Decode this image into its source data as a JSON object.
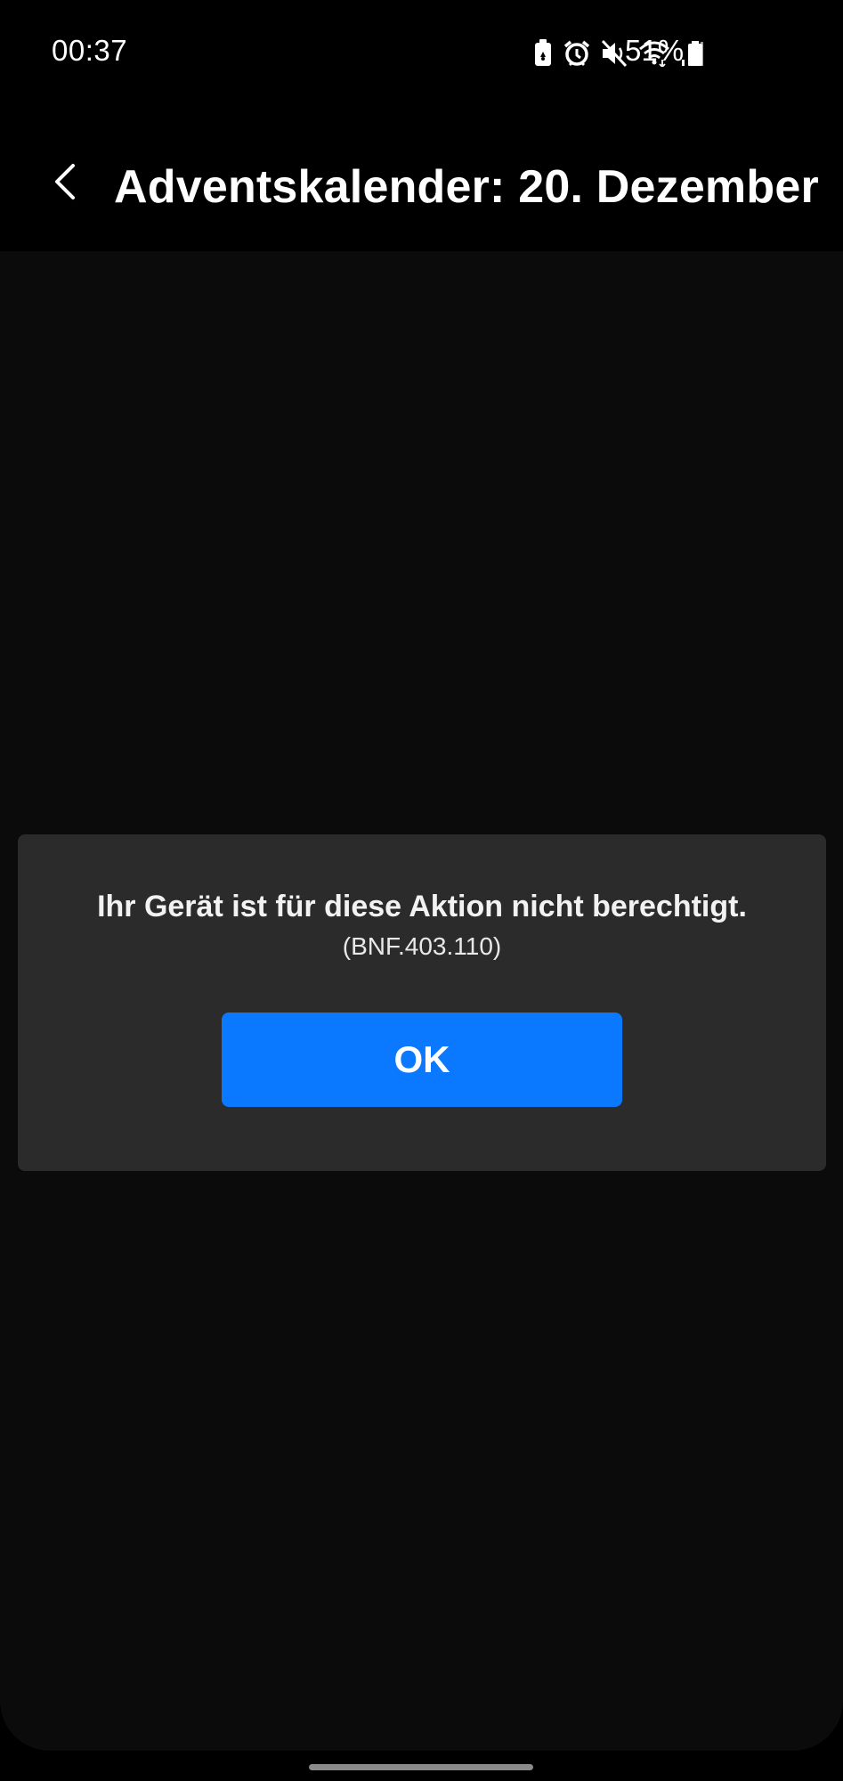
{
  "status_bar": {
    "time": "00:37",
    "battery_percent": "51%",
    "icons": [
      "battery-saver-icon",
      "alarm-icon",
      "mute-icon",
      "wifi-icon",
      "signal-icon",
      "battery-icon"
    ]
  },
  "header": {
    "title": "Adventskalender: 20. Dezember"
  },
  "dialog": {
    "message": "Ihr Gerät ist für diese Aktion nicht berechtigt.",
    "code": "(BNF.403.110)",
    "ok_label": "OK"
  },
  "colors": {
    "accent": "#0a78ff",
    "dialog_bg": "#2b2b2b",
    "content_bg": "#0b0b0b",
    "background": "#000000"
  }
}
